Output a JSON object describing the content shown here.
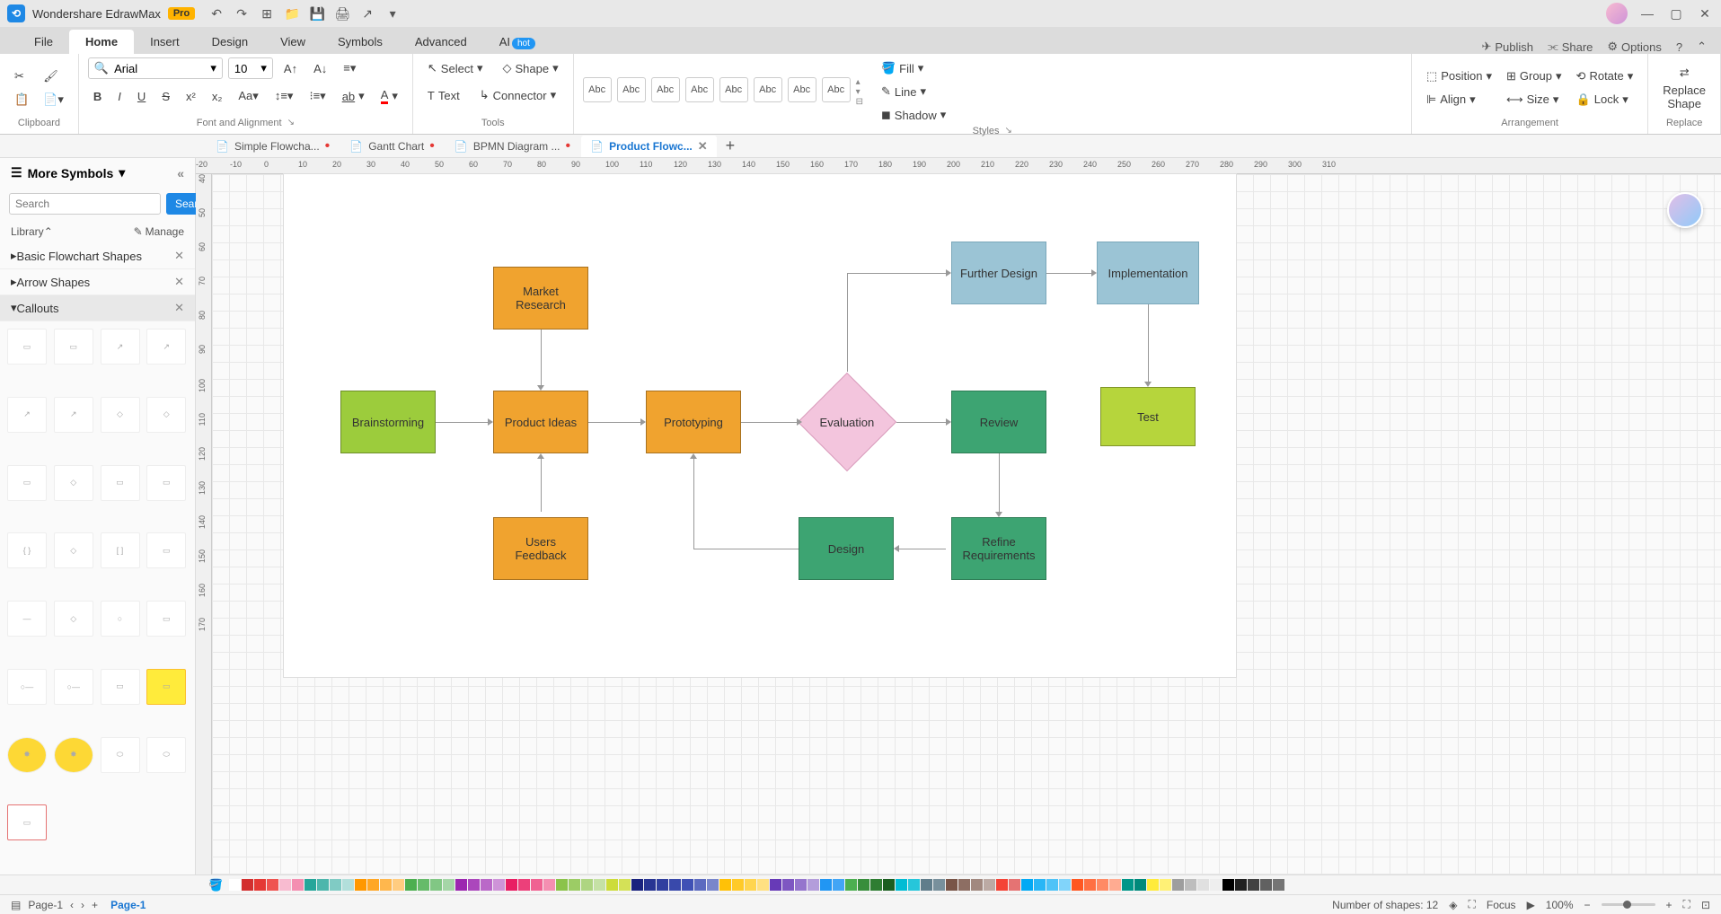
{
  "titlebar": {
    "app_name": "Wondershare EdrawMax",
    "pro": "Pro"
  },
  "menu": {
    "tabs": [
      "File",
      "Home",
      "Insert",
      "Design",
      "View",
      "Symbols",
      "Advanced",
      "AI"
    ],
    "active": "Home",
    "hot": "hot",
    "publish": "Publish",
    "share": "Share",
    "options": "Options"
  },
  "ribbon": {
    "clipboard": "Clipboard",
    "font_alignment": "Font and Alignment",
    "tools": "Tools",
    "styles": "Styles",
    "arrangement": "Arrangement",
    "replace": "Replace",
    "font_name": "Arial",
    "font_size": "10",
    "select": "Select",
    "text": "Text",
    "shape": "Shape",
    "connector": "Connector",
    "abc": "Abc",
    "fill": "Fill",
    "line": "Line",
    "shadow": "Shadow",
    "position": "Position",
    "align": "Align",
    "group": "Group",
    "size": "Size",
    "rotate": "Rotate",
    "lock": "Lock",
    "replace_shape": "Replace\nShape"
  },
  "doctabs": [
    {
      "label": "Simple Flowcha...",
      "dirty": true,
      "active": false
    },
    {
      "label": "Gantt Chart",
      "dirty": true,
      "active": false
    },
    {
      "label": "BPMN Diagram ...",
      "dirty": true,
      "active": false
    },
    {
      "label": "Product Flowc...",
      "dirty": false,
      "active": true
    }
  ],
  "sidebar": {
    "more_symbols": "More Symbols",
    "search_placeholder": "Search",
    "search_btn": "Search",
    "library": "Library",
    "manage": "Manage",
    "cats": [
      "Basic Flowchart Shapes",
      "Arrow Shapes",
      "Callouts"
    ]
  },
  "shapes": {
    "brainstorming": "Brainstorming",
    "market_research": "Market\nResearch",
    "product_ideas": "Product Ideas",
    "prototyping": "Prototyping",
    "users_feedback": "Users\nFeedback",
    "evaluation": "Evaluation",
    "review": "Review",
    "refine": "Refine\nRequirements",
    "design": "Design",
    "further_design": "Further Design",
    "implementation": "Implementation",
    "test": "Test"
  },
  "ruler_h": [
    "-20",
    "-10",
    "0",
    "10",
    "20",
    "30",
    "40",
    "50",
    "60",
    "70",
    "80",
    "90",
    "100",
    "110",
    "120",
    "130",
    "140",
    "150",
    "160",
    "170",
    "180",
    "190",
    "200",
    "210",
    "220",
    "230",
    "240",
    "250",
    "260",
    "270",
    "280",
    "290",
    "300",
    "310"
  ],
  "ruler_v": [
    "40",
    "50",
    "60",
    "70",
    "80",
    "90",
    "100",
    "110",
    "120",
    "130",
    "140",
    "150",
    "160",
    "170"
  ],
  "colors": [
    "#ffffff",
    "#d32f2f",
    "#e53935",
    "#ef5350",
    "#f8bbd0",
    "#f48fb1",
    "#26a69a",
    "#4db6ac",
    "#80cbc4",
    "#b2dfdb",
    "#ff9800",
    "#ffa726",
    "#ffb74d",
    "#ffcc80",
    "#4caf50",
    "#66bb6a",
    "#81c784",
    "#a5d6a7",
    "#9c27b0",
    "#ab47bc",
    "#ba68c8",
    "#ce93d8",
    "#e91e63",
    "#ec407a",
    "#f06292",
    "#f48fb1",
    "#8bc34a",
    "#9ccc65",
    "#aed581",
    "#c5e1a5",
    "#cddc39",
    "#d4e157",
    "#1a237e",
    "#283593",
    "#303f9f",
    "#3949ab",
    "#3f51b5",
    "#5c6bc0",
    "#7986cb",
    "#ffc107",
    "#ffca28",
    "#ffd54f",
    "#ffe082",
    "#673ab7",
    "#7e57c2",
    "#9575cd",
    "#b39ddb",
    "#2196f3",
    "#42a5f5",
    "#4caf50",
    "#388e3c",
    "#2e7d32",
    "#1b5e20",
    "#00bcd4",
    "#26c6da",
    "#607d8b",
    "#78909c",
    "#795548",
    "#8d6e63",
    "#a1887f",
    "#bcaaa4",
    "#f44336",
    "#e57373",
    "#03a9f4",
    "#29b6f6",
    "#4fc3f7",
    "#81d4fa",
    "#ff5722",
    "#ff7043",
    "#ff8a65",
    "#ffab91",
    "#009688",
    "#00897b",
    "#ffeb3b",
    "#fff176",
    "#9e9e9e",
    "#bdbdbd",
    "#e0e0e0",
    "#eeeeee",
    "#000000",
    "#212121",
    "#424242",
    "#616161",
    "#757575"
  ],
  "status": {
    "page1": "Page-1",
    "page1b": "Page-1",
    "shapes_count": "Number of shapes: 12",
    "focus": "Focus",
    "zoom": "100%"
  }
}
